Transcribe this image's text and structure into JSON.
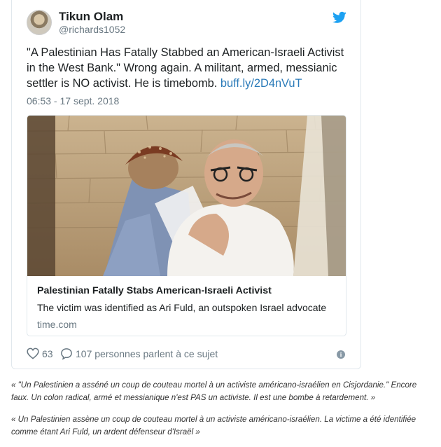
{
  "tweet": {
    "display_name": "Tikun Olam",
    "handle": "@richards1052",
    "text": "\"A Palestinian Has Fatally Stabbed an American-Israeli Activist in the West Bank.\" Wrong again. A militant, armed, messianic settler is NO activist. He is timebomb. ",
    "link": "buff.ly/2D4nVuT",
    "timestamp": "06:53 - 17 sept. 2018",
    "card": {
      "title": "Palestinian Fatally Stabs American-Israeli Activist",
      "description": "The victim was identified as Ari Fuld, an outspoken Israel advocate",
      "domain": "time.com",
      "image_icon": "photo-two-men-embracing"
    },
    "likes": "63",
    "talking": "107 personnes parlent à ce sujet",
    "colors": {
      "link": "#2b7bb9",
      "twitter_blue": "#1da1f2",
      "muted": "#697882"
    }
  },
  "translations": {
    "quote1": "« \"Un Palestinien a asséné un coup de couteau mortel à un activiste américano-israélien en Cisjordanie.\" Encore faux. Un colon radical, armé et messianique n'est PAS un activiste. Il est une bombe à retardement. »",
    "quote2": "« Un Palestinien assène un coup de couteau mortel à un activiste américano-israélien. La victime a été identifiée comme étant Ari Fuld, un ardent défenseur d'Israël »"
  }
}
